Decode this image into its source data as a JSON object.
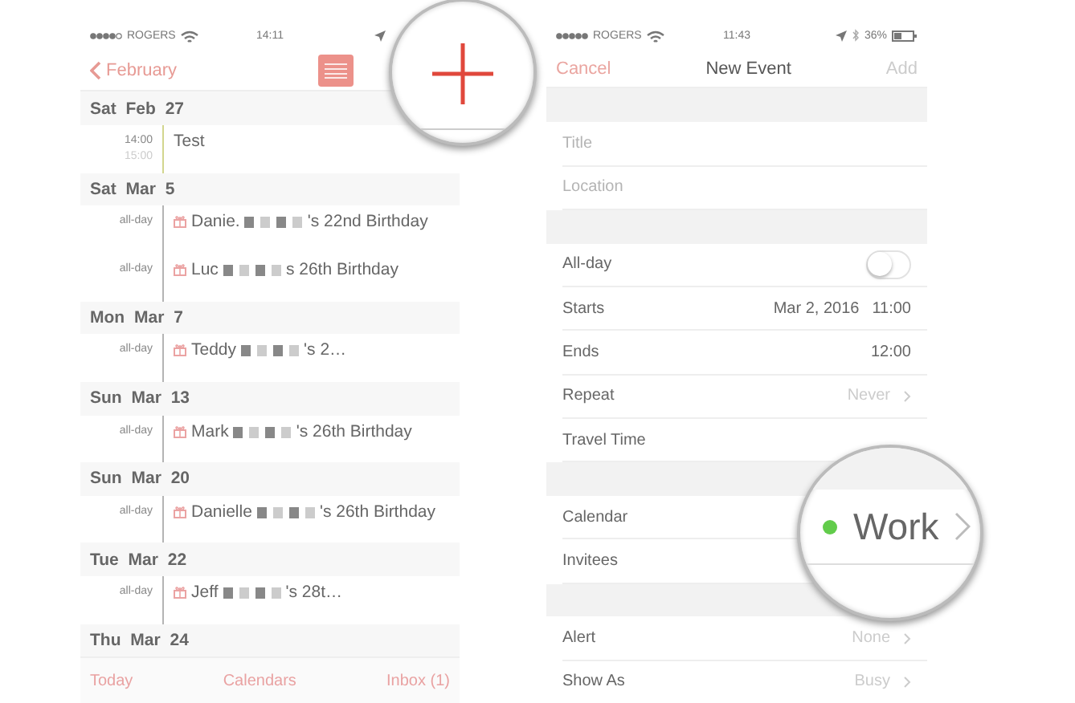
{
  "calendar_list": {
    "status_bar": {
      "carrier": "ROGERS",
      "time": "14:11"
    },
    "nav": {
      "back": "February"
    },
    "days": [
      {
        "date": "Sat Feb 27",
        "events": [
          {
            "kind": "timed",
            "start": "14:00",
            "end": "15:00",
            "name": "Test",
            "color": "#d2d68e"
          }
        ]
      },
      {
        "date": "Sat Mar 5",
        "events": [
          {
            "kind": "birthday",
            "start": "all-day",
            "name": "Danie.",
            "suffix": "'s 22nd Birthday",
            "color": "#b4b4b4"
          },
          {
            "kind": "birthday",
            "start": "all-day",
            "name": "Luc",
            "suffix": "s 26th Birthday",
            "color": "#b4b4b4"
          }
        ]
      },
      {
        "date": "Mon Mar 7",
        "events": [
          {
            "kind": "birthday",
            "start": "all-day",
            "name": "Teddy",
            "suffix": "'s 2…",
            "color": "#b4b4b4"
          }
        ]
      },
      {
        "date": "Sun Mar 13",
        "events": [
          {
            "kind": "birthday",
            "start": "all-day",
            "name": "Mark",
            "suffix": "'s 26th Birthday",
            "color": "#b4b4b4"
          }
        ]
      },
      {
        "date": "Sun Mar 20",
        "events": [
          {
            "kind": "birthday",
            "start": "all-day",
            "name": "Danielle",
            "suffix": "'s 26th Birthday",
            "color": "#b4b4b4"
          }
        ]
      },
      {
        "date": "Tue Mar 22",
        "events": [
          {
            "kind": "birthday",
            "start": "all-day",
            "name": "Jeff",
            "suffix": "'s 28t…",
            "color": "#b4b4b4"
          }
        ]
      },
      {
        "date": "Thu Mar 24"
      }
    ],
    "tab_bar": [
      "Today",
      "Calendars",
      "Inbox (1)"
    ]
  },
  "new_event": {
    "status_bar": {
      "carrier": "ROGERS",
      "time": "11:43",
      "battery": "36%"
    },
    "nav": {
      "cancel": "Cancel",
      "title": "New Event",
      "add": "Add",
      "add_disabled": true
    },
    "sections": [
      {
        "rows": [
          {
            "kind": "input",
            "placeholder": "Title"
          },
          {
            "kind": "input",
            "placeholder": "Location"
          }
        ]
      },
      {
        "rows": [
          {
            "kind": "toggle",
            "label": "All-day",
            "on": false
          },
          {
            "kind": "value",
            "label": "Starts",
            "date": "Mar 2, 2016",
            "value": "11:00"
          },
          {
            "kind": "value",
            "label": "Ends",
            "value": "12:00"
          },
          {
            "kind": "link",
            "label": "Repeat",
            "value": "Never"
          },
          {
            "kind": "plain",
            "label": "Travel Time"
          }
        ]
      },
      {
        "rows": [
          {
            "kind": "calendar",
            "label": "Calendar",
            "value": "Work",
            "color": "#62cc4b"
          },
          {
            "kind": "plain",
            "label": "Invitees"
          }
        ]
      },
      {
        "rows": [
          {
            "kind": "link",
            "label": "Alert",
            "value": "None"
          },
          {
            "kind": "link",
            "label": "Show As",
            "value": "Busy"
          }
        ]
      }
    ]
  }
}
